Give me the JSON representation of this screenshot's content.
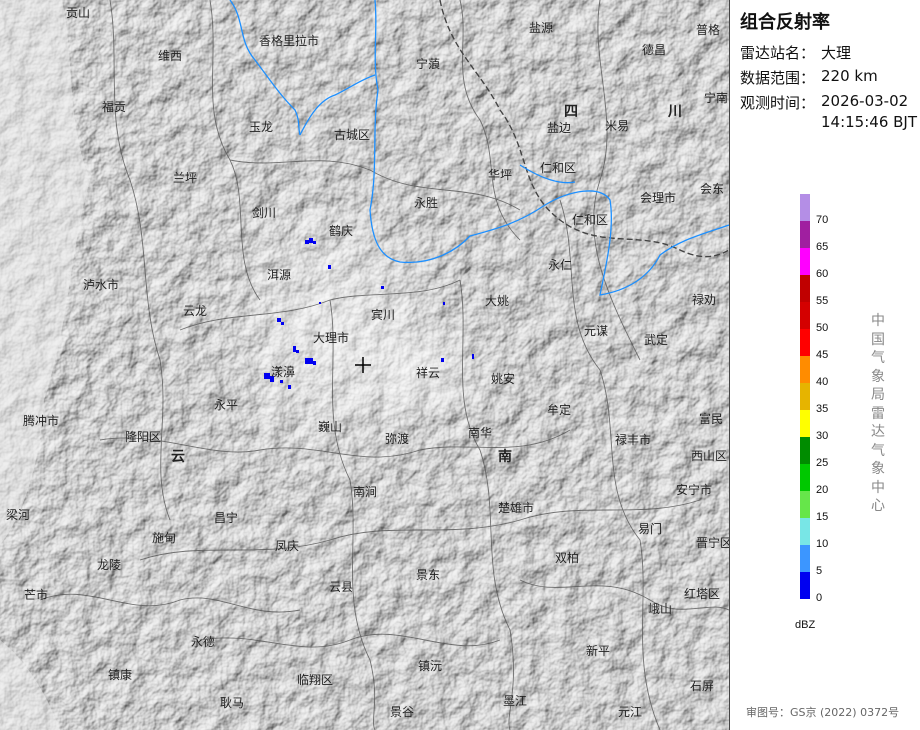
{
  "panel": {
    "title": "组合反射率",
    "station_label": "雷达站名：",
    "station_value": "大理",
    "range_label": "数据范围：",
    "range_value": "220 km",
    "time_label": "观测时间：",
    "time_value_line1": "2026-03-02",
    "time_value_line2": "14:15:46 BJT",
    "unit": "dBZ",
    "agency": "中国气象局雷达气象中心",
    "approval": "审图号：GS京 (2022) 0372号"
  },
  "legend": [
    {
      "label": "",
      "color": "#b48ee6"
    },
    {
      "label": "70",
      "color": "#a01fa0"
    },
    {
      "label": "65",
      "color": "#ff00ff"
    },
    {
      "label": "60",
      "color": "#c00000"
    },
    {
      "label": "55",
      "color": "#d40000"
    },
    {
      "label": "50",
      "color": "#ff0000"
    },
    {
      "label": "45",
      "color": "#ff8c00"
    },
    {
      "label": "40",
      "color": "#e6b400"
    },
    {
      "label": "35",
      "color": "#ffff00"
    },
    {
      "label": "30",
      "color": "#008c00"
    },
    {
      "label": "25",
      "color": "#00c800"
    },
    {
      "label": "20",
      "color": "#66e64a"
    },
    {
      "label": "15",
      "color": "#78e6e6"
    },
    {
      "label": "10",
      "color": "#3c96ff"
    },
    {
      "label": "5",
      "color": "#0000f0"
    },
    {
      "label": "0",
      "color": ""
    }
  ],
  "map": {
    "radar_site": "大理",
    "places": [
      {
        "name": "贡山"
      },
      {
        "name": "维西"
      },
      {
        "name": "香格里拉市"
      },
      {
        "name": "盐源"
      },
      {
        "name": "普格"
      },
      {
        "name": "德昌"
      },
      {
        "name": "宁南"
      },
      {
        "name": "宁蒗"
      },
      {
        "name": "福贡"
      },
      {
        "name": "玉龙"
      },
      {
        "name": "古城区"
      },
      {
        "name": "盐边"
      },
      {
        "name": "米易"
      },
      {
        "name": "仁和区"
      },
      {
        "name": "华坪"
      },
      {
        "name": "兰坪"
      },
      {
        "name": "剑川"
      },
      {
        "name": "鹤庆"
      },
      {
        "name": "永胜"
      },
      {
        "name": "会理市"
      },
      {
        "name": "会东"
      },
      {
        "name": "仁和区"
      },
      {
        "name": "洱源"
      },
      {
        "name": "永仁"
      },
      {
        "name": "泸水市"
      },
      {
        "name": "云龙"
      },
      {
        "name": "大理市"
      },
      {
        "name": "宾川"
      },
      {
        "name": "大姚"
      },
      {
        "name": "禄劝"
      },
      {
        "name": "元谋"
      },
      {
        "name": "武定"
      },
      {
        "name": "漾濞"
      },
      {
        "name": "祥云"
      },
      {
        "name": "姚安"
      },
      {
        "name": "永平"
      },
      {
        "name": "牟定"
      },
      {
        "name": "富民"
      },
      {
        "name": "腾冲市"
      },
      {
        "name": "巍山"
      },
      {
        "name": "隆阳区"
      },
      {
        "name": "弥渡"
      },
      {
        "name": "南华"
      },
      {
        "name": "禄丰市"
      },
      {
        "name": "西山区"
      },
      {
        "name": "南涧"
      },
      {
        "name": "安宁市"
      },
      {
        "name": "楚雄市"
      },
      {
        "name": "梁河"
      },
      {
        "name": "昌宁"
      },
      {
        "name": "施甸"
      },
      {
        "name": "易门"
      },
      {
        "name": "凤庆"
      },
      {
        "name": "双柏"
      },
      {
        "name": "晋宁区"
      },
      {
        "name": "龙陵"
      },
      {
        "name": "景东"
      },
      {
        "name": "芒市"
      },
      {
        "name": "云县"
      },
      {
        "name": "红塔区"
      },
      {
        "name": "永德"
      },
      {
        "name": "峨山"
      },
      {
        "name": "镇沅"
      },
      {
        "name": "新平"
      },
      {
        "name": "镇康"
      },
      {
        "name": "临翔区"
      },
      {
        "name": "耿马"
      },
      {
        "name": "墨江"
      },
      {
        "name": "石屏"
      },
      {
        "name": "景谷"
      },
      {
        "name": "元江"
      }
    ],
    "provinces": [
      {
        "name": "四"
      },
      {
        "name": "川"
      },
      {
        "name": "云"
      },
      {
        "name": "南"
      }
    ]
  },
  "colors": {
    "river": "#1e90ff",
    "border": "#555555",
    "echo": "#0000f0",
    "land": "#cfcfcf"
  }
}
